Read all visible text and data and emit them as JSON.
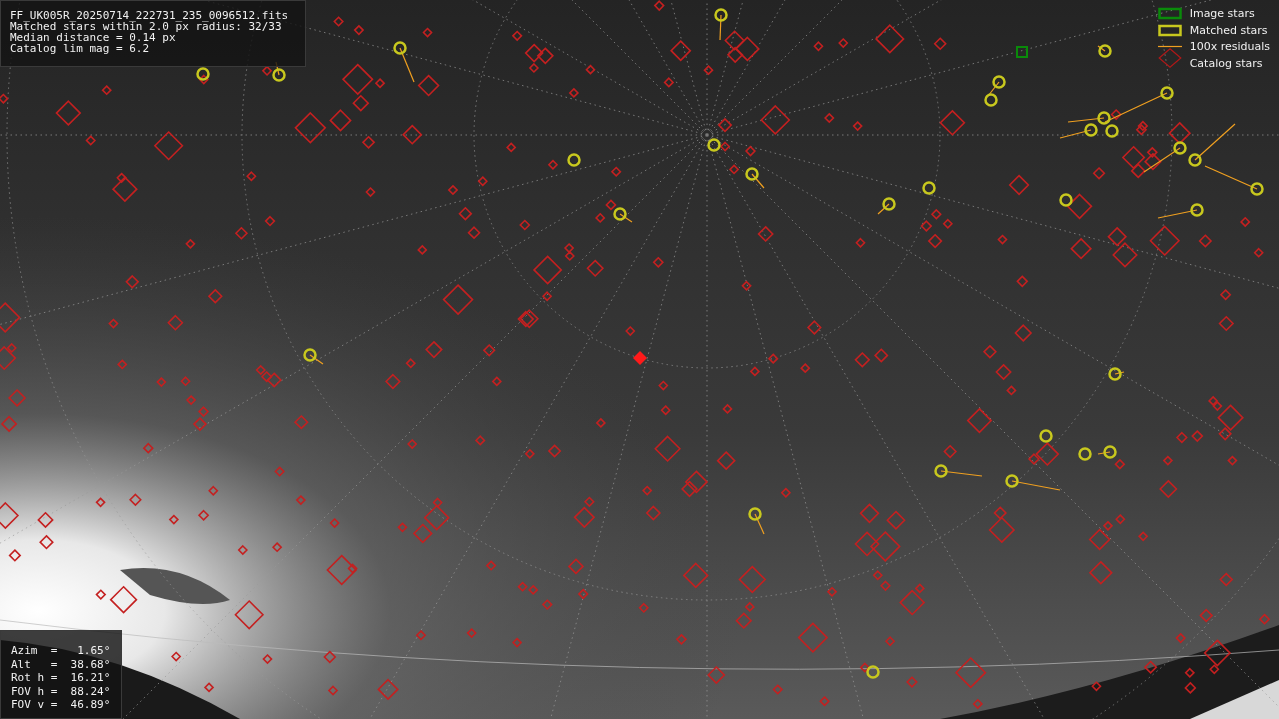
{
  "file_info": {
    "lines": [
      "FF_UK005R_20250714_222731_235_0096512.fits",
      "Matched stars within 2.0 px radius: 32/33",
      "Median distance = 0.14 px",
      "Catalog lim mag = 6.2"
    ]
  },
  "legend": [
    {
      "kind": "image",
      "label": "Image stars"
    },
    {
      "kind": "matched",
      "label": "Matched stars"
    },
    {
      "kind": "residual",
      "label": "100x residuals"
    },
    {
      "kind": "catalog",
      "label": "Catalog stars"
    }
  ],
  "pointing": {
    "lines": [
      "Azim  =   1.65°",
      "Alt   =  38.68°",
      "Rot h =  16.21°",
      "FOV h =  88.24°",
      "FOV v =  46.89°"
    ]
  }
}
